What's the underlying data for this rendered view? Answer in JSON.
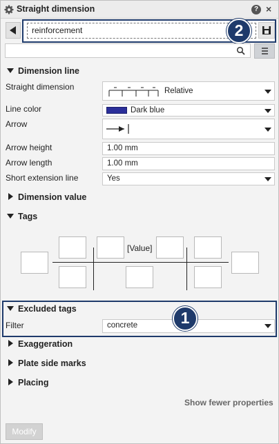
{
  "window": {
    "title": "Straight dimension",
    "help_icon": "?",
    "close_icon": "×"
  },
  "toolbar": {
    "preset_value": "reinforcement"
  },
  "callouts": {
    "one": "1",
    "two": "2"
  },
  "dimension_line": {
    "header": "Dimension line",
    "rows": [
      {
        "label": "Straight dimension",
        "value": "Relative"
      },
      {
        "label": "Line color",
        "value": "Dark blue"
      },
      {
        "label": "Arrow",
        "value": ""
      },
      {
        "label": "Arrow height",
        "value": "1.00 mm"
      },
      {
        "label": "Arrow length",
        "value": "1.00 mm"
      },
      {
        "label": "Short extension line",
        "value": "Yes"
      }
    ],
    "line_color_swatch": "#2b2f9a"
  },
  "dimension_value": {
    "header": "Dimension value"
  },
  "tags": {
    "header": "Tags",
    "value_placeholder": "[Value]"
  },
  "excluded_tags": {
    "header": "Excluded tags",
    "filter_label": "Filter",
    "filter_value": "concrete"
  },
  "sections": {
    "exaggeration": "Exaggeration",
    "plate_side_marks": "Plate side marks",
    "placing": "Placing"
  },
  "footer": {
    "show_fewer": "Show fewer properties",
    "modify": "Modify"
  },
  "colors": {
    "accent": "#1e3a6b",
    "panel_bg": "#f3f3f3"
  }
}
